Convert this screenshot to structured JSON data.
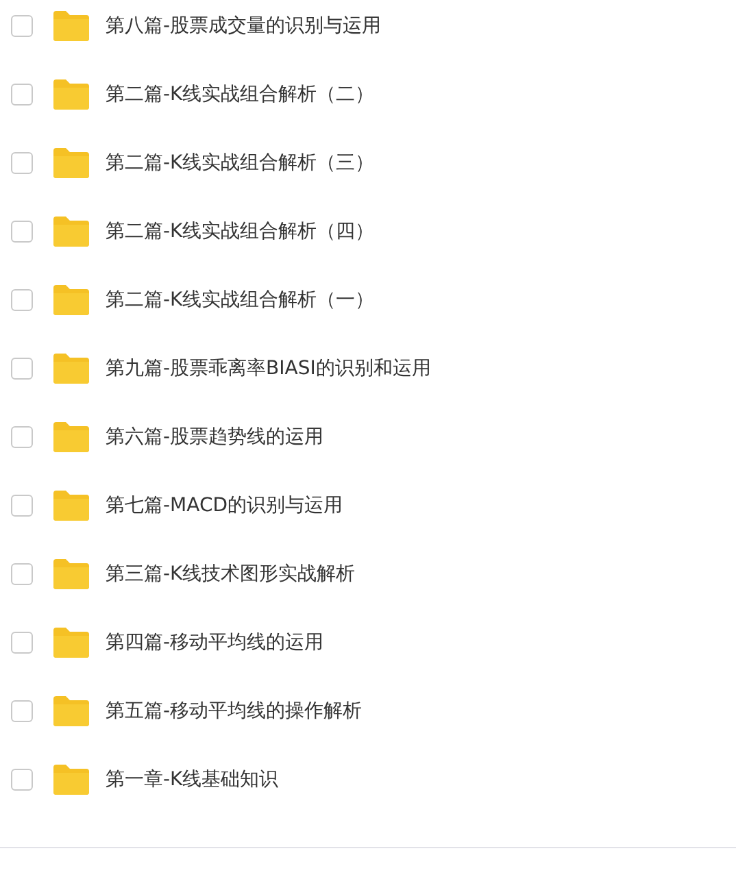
{
  "items": [
    {
      "name": "第八篇-股票成交量的识别与运用",
      "checked": false
    },
    {
      "name": "第二篇-K线实战组合解析（二）",
      "checked": false
    },
    {
      "name": "第二篇-K线实战组合解析（三）",
      "checked": false
    },
    {
      "name": "第二篇-K线实战组合解析（四）",
      "checked": false
    },
    {
      "name": "第二篇-K线实战组合解析（一）",
      "checked": false
    },
    {
      "name": "第九篇-股票乖离率BIASI的识别和运用",
      "checked": false
    },
    {
      "name": "第六篇-股票趋势线的运用",
      "checked": false
    },
    {
      "name": "第七篇-MACD的识别与运用",
      "checked": false
    },
    {
      "name": "第三篇-K线技术图形实战解析",
      "checked": false
    },
    {
      "name": "第四篇-移动平均线的运用",
      "checked": false
    },
    {
      "name": "第五篇-移动平均线的操作解析",
      "checked": false
    },
    {
      "name": "第一章-K线基础知识",
      "checked": false
    }
  ]
}
